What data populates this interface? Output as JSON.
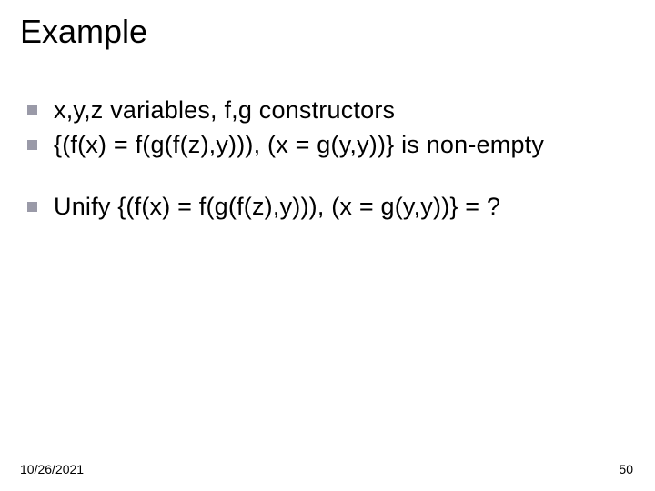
{
  "title": "Example",
  "bullets": {
    "b1": "x,y,z variables, f,g constructors",
    "b2": "{(f(x) = f(g(f(z),y))), (x = g(y,y))} is non-empty",
    "b3": "Unify {(f(x) = f(g(f(z),y))), (x = g(y,y))} = ?"
  },
  "footer": {
    "date": "10/26/2021",
    "page": "50"
  }
}
